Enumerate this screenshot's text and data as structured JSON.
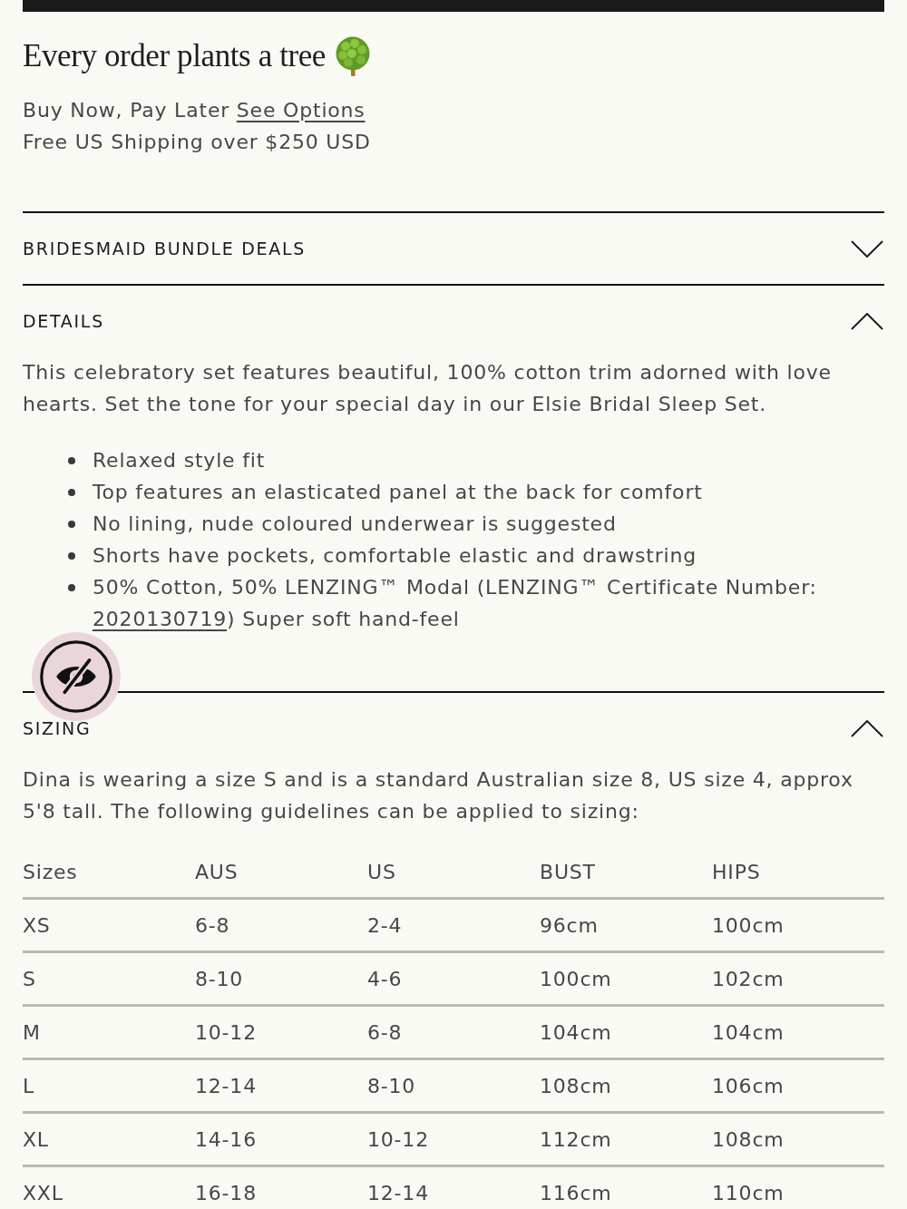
{
  "promo": {
    "heading": "Every order plants a tree",
    "payment_text": "Buy Now, Pay Later",
    "payment_link": "See Options",
    "shipping": "Free US Shipping over $250 USD"
  },
  "sections": [
    {
      "kind": "deals",
      "title": "BRIDESMAID BUNDLE DEALS",
      "expanded": false
    },
    {
      "kind": "details",
      "title": "DETAILS",
      "expanded": true,
      "paragraph": "This celebratory set features beautiful, 100% cotton trim adorned with love hearts. Set the tone for your special day in our Elsie Bridal Sleep Set.",
      "bullets": [
        {
          "text": "Relaxed style fit"
        },
        {
          "text": "Top features an elasticated panel at the back for comfort"
        },
        {
          "text": "No lining, nude coloured underwear is suggested"
        },
        {
          "text": "Shorts have pockets, comfortable elastic and drawstring"
        },
        {
          "text": "50% Cotton, 50% LENZING™ Modal (LENZING™ Certificate Number:",
          "link": "2020130719",
          "after": ") Super soft hand-feel"
        }
      ]
    },
    {
      "kind": "sizing",
      "title": "SIZING",
      "expanded": true,
      "paragraph": "Dina is wearing a size S and is a standard Australian size 8, US size 4, approx 5'8 tall. The following guidelines can be applied to sizing:",
      "table": {
        "columns": [
          "Sizes",
          "AUS",
          "US",
          "BUST",
          "HIPS"
        ],
        "rows": [
          [
            "XS",
            "6-8",
            "2-4",
            "96cm",
            "100cm"
          ],
          [
            "S",
            "8-10",
            "4-6",
            "100cm",
            "102cm"
          ],
          [
            "M",
            "10-12",
            "6-8",
            "104cm",
            "104cm"
          ],
          [
            "L",
            "12-14",
            "8-10",
            "108cm",
            "106cm"
          ],
          [
            "XL",
            "14-16",
            "10-12",
            "112cm",
            "108cm"
          ],
          [
            "XXL",
            "16-18",
            "12-14",
            "116cm",
            "110cm"
          ]
        ]
      }
    }
  ]
}
